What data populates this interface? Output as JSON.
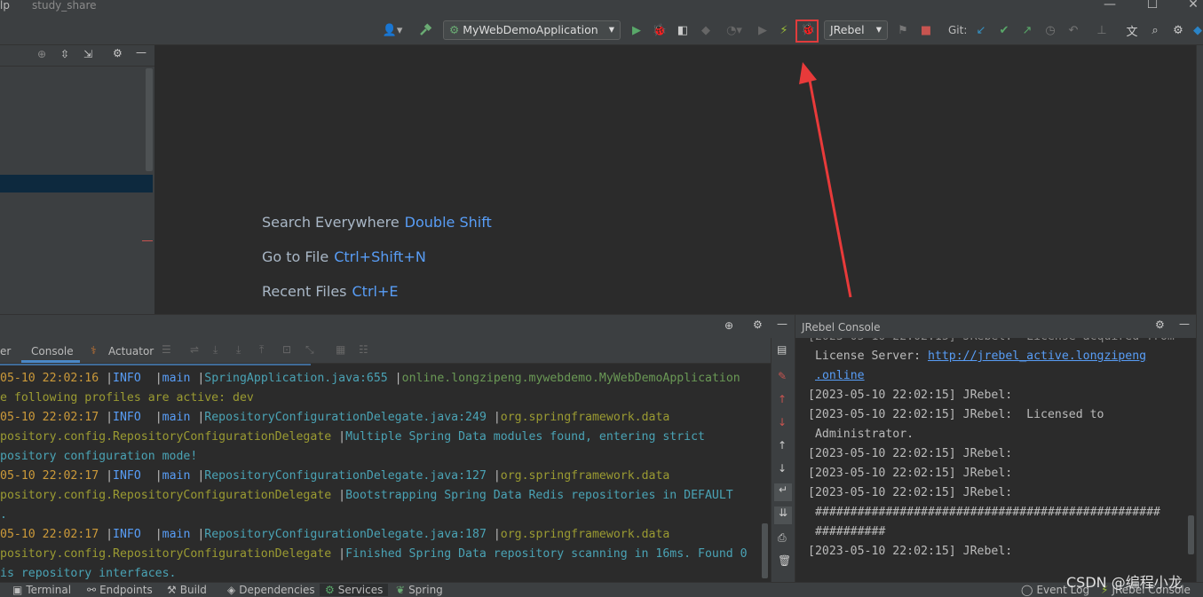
{
  "window": {
    "title_partial": "lp",
    "project_name": "study_share",
    "controls": [
      "—",
      "☐",
      "✕"
    ]
  },
  "toolbar": {
    "run_config": "MyWebDemoApplication",
    "jrebel_combo": "JRebel",
    "git_label": "Git:"
  },
  "editor": {
    "hints": [
      {
        "label": "Search Everywhere",
        "key": "Double Shift"
      },
      {
        "label": "Go to File",
        "key": "Ctrl+Shift+N"
      },
      {
        "label": "Recent Files",
        "key": "Ctrl+E"
      }
    ]
  },
  "services": {
    "tabs": [
      {
        "label": "er"
      },
      {
        "label": "Console"
      },
      {
        "label": "Actuator"
      }
    ],
    "console_lines": [
      {
        "ts": "05-10 22:02:16",
        "level": "INFO",
        "thread": "main",
        "src": "SpringApplication.java:655",
        "logger": "online.longzipeng.mywebdemo.MyWebDemoApplication"
      },
      {
        "text": "e following profiles are active: dev"
      },
      {
        "ts": "05-10 22:02:17",
        "level": "INFO",
        "thread": "main",
        "src": "RepositoryConfigurationDelegate.java:249",
        "logger": "org.springframework.data"
      },
      {
        "pre": "pository.config.RepositoryConfigurationDelegate",
        "msg": "Multiple Spring Data modules found, entering strict"
      },
      {
        "text": "pository configuration mode!"
      },
      {
        "ts": "05-10 22:02:17",
        "level": "INFO",
        "thread": "main",
        "src": "RepositoryConfigurationDelegate.java:127",
        "logger": "org.springframework.data"
      },
      {
        "pre": "pository.config.RepositoryConfigurationDelegate",
        "msg": "Bootstrapping Spring Data Redis repositories in DEFAULT"
      },
      {
        "text": "."
      },
      {
        "ts": "05-10 22:02:17",
        "level": "INFO",
        "thread": "main",
        "src": "RepositoryConfigurationDelegate.java:187",
        "logger": "org.springframework.data"
      },
      {
        "pre": "pository.config.RepositoryConfigurationDelegate",
        "msg": "Finished Spring Data repository scanning in 16ms. Found 0"
      },
      {
        "text": "is repository interfaces."
      }
    ]
  },
  "jrebel": {
    "title": "JRebel Console",
    "lines": [
      {
        "text": "[2023-05-10 22:02:15] JRebel:  License acquired from"
      },
      {
        "text": " License Server: ",
        "link": "http://jrebel_active.longzipeng"
      },
      {
        "text": "",
        "link": ".online"
      },
      {
        "text": "[2023-05-10 22:02:15] JRebel:"
      },
      {
        "text": "[2023-05-10 22:02:15] JRebel:  Licensed to"
      },
      {
        "text": " Administrator."
      },
      {
        "text": "[2023-05-10 22:02:15] JRebel:"
      },
      {
        "text": "[2023-05-10 22:02:15] JRebel:"
      },
      {
        "text": "[2023-05-10 22:02:15] JRebel:"
      },
      {
        "text": " #################################################"
      },
      {
        "text": " ##########"
      },
      {
        "text": "[2023-05-10 22:02:15] JRebel:"
      }
    ]
  },
  "statusbar": {
    "items": [
      "Terminal",
      "Endpoints",
      "Build",
      "Dependencies",
      "Services",
      "Spring"
    ],
    "right_items": [
      "Event Log",
      "JRebel Console"
    ]
  },
  "watermark": "CSDN @编程小龙",
  "colors": {
    "highlight_box": "#e03c3c",
    "arrow": "#e83a3a"
  }
}
